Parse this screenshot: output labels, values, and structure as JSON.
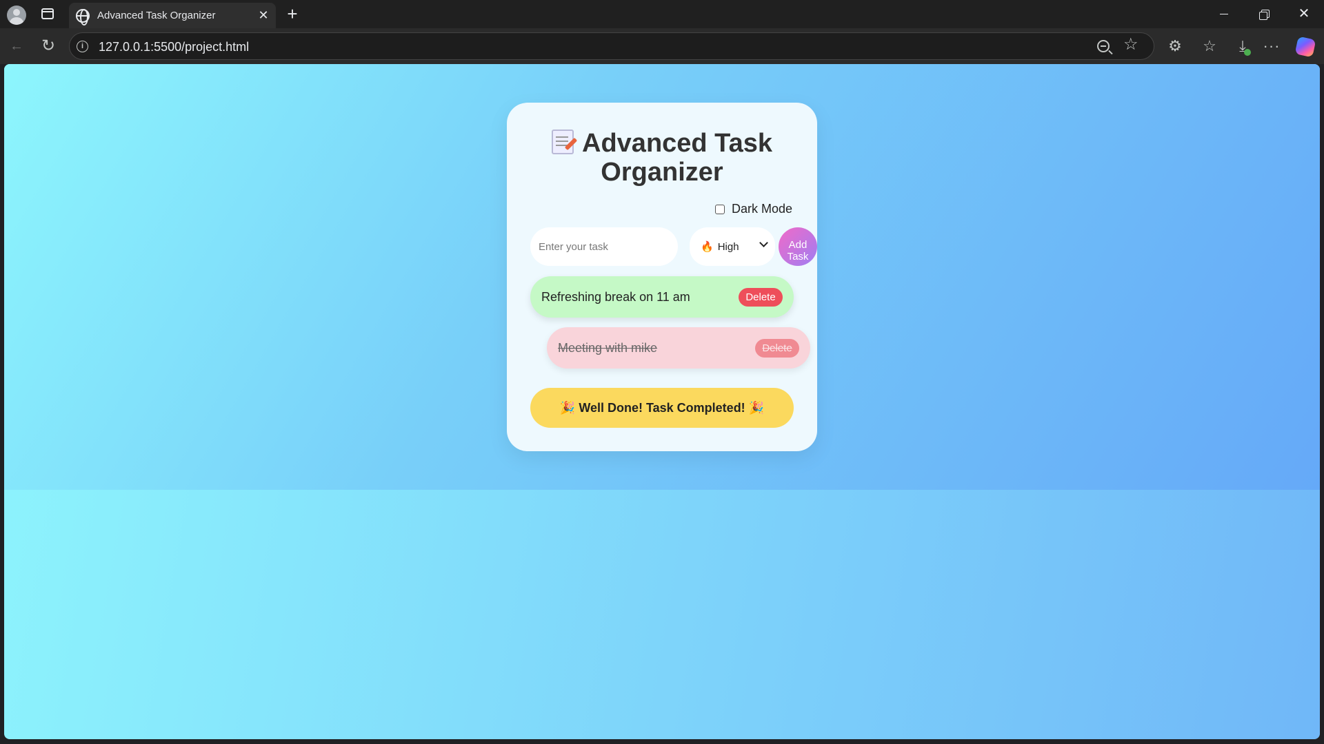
{
  "browser": {
    "tab_title": "Advanced Task Organizer",
    "tab_close": "✕",
    "new_tab": "+",
    "url": "127.0.0.1:5500/project.html",
    "window_close": "✕",
    "icons": [
      "profile-icon",
      "tabs-icon",
      "globe-icon",
      "back-icon",
      "reload-icon",
      "info-icon",
      "zoom-out-icon",
      "star-icon",
      "extensions-icon",
      "favorites-icon",
      "downloads-icon",
      "more-icon",
      "copilot-icon"
    ]
  },
  "app": {
    "heading": "Advanced Task Organizer",
    "dark_mode_label": "Dark Mode",
    "dark_mode_checked": false,
    "task_input": {
      "placeholder": "Enter your task",
      "value": ""
    },
    "priority": {
      "selected": "High",
      "icon": "flame-icon"
    },
    "add_button_label": "Add Task",
    "tasks": [
      {
        "text": "Refreshing break on 11 am",
        "completed": false,
        "delete_label": "Delete"
      },
      {
        "text": "Meeting with mike",
        "completed": true,
        "delete_label": "Delete"
      }
    ],
    "completion_banner": "Well Done! Task Completed!"
  },
  "colors": {
    "background_start": "#8ef6fd",
    "background_end": "#65a9f8",
    "card": "#eef9fe",
    "task_active": "#c5f9c6",
    "task_completed": "#f9d4da",
    "delete_button": "#ee4e5a",
    "add_button_start": "#f06ac8",
    "add_button_end": "#9f7ef2",
    "banner": "#fbd95e"
  }
}
